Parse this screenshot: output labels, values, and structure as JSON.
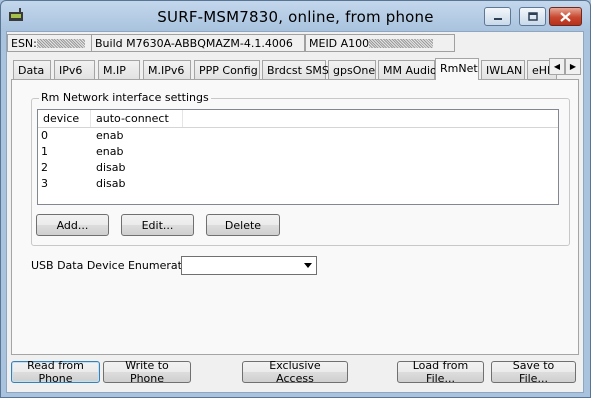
{
  "window": {
    "title": "SURF-MSM7830, online, from phone"
  },
  "info": {
    "esn_label": "ESN:",
    "build": "Build M7630A-ABBQMAZM-4.1.4006",
    "meid_label": "MEID A100"
  },
  "tabs": [
    {
      "label": "Data"
    },
    {
      "label": "IPv6"
    },
    {
      "label": "M.IP"
    },
    {
      "label": "M.IPv6"
    },
    {
      "label": "PPP Config"
    },
    {
      "label": "Brdcst SMS"
    },
    {
      "label": "gpsOne"
    },
    {
      "label": "MM Audio"
    },
    {
      "label": "RmNet",
      "active": true
    },
    {
      "label": "IWLAN"
    },
    {
      "label": "eHF"
    }
  ],
  "rm": {
    "group_title": "Rm Network interface settings",
    "columns": [
      "device",
      "auto-connect"
    ],
    "rows": [
      {
        "device": "0",
        "auto": "enab"
      },
      {
        "device": "1",
        "auto": "enab"
      },
      {
        "device": "2",
        "auto": "disab"
      },
      {
        "device": "3",
        "auto": "disab"
      }
    ],
    "add_label": "Add...",
    "edit_label": "Edit...",
    "delete_label": "Delete"
  },
  "usb": {
    "label": "USB Data Device Enumeration",
    "value": ""
  },
  "footer": {
    "read_label": "Read from Phone",
    "write_label": "Write to Phone",
    "exclusive_label": "Exclusive Access",
    "load_label": "Load from File...",
    "save_label": "Save to File..."
  }
}
